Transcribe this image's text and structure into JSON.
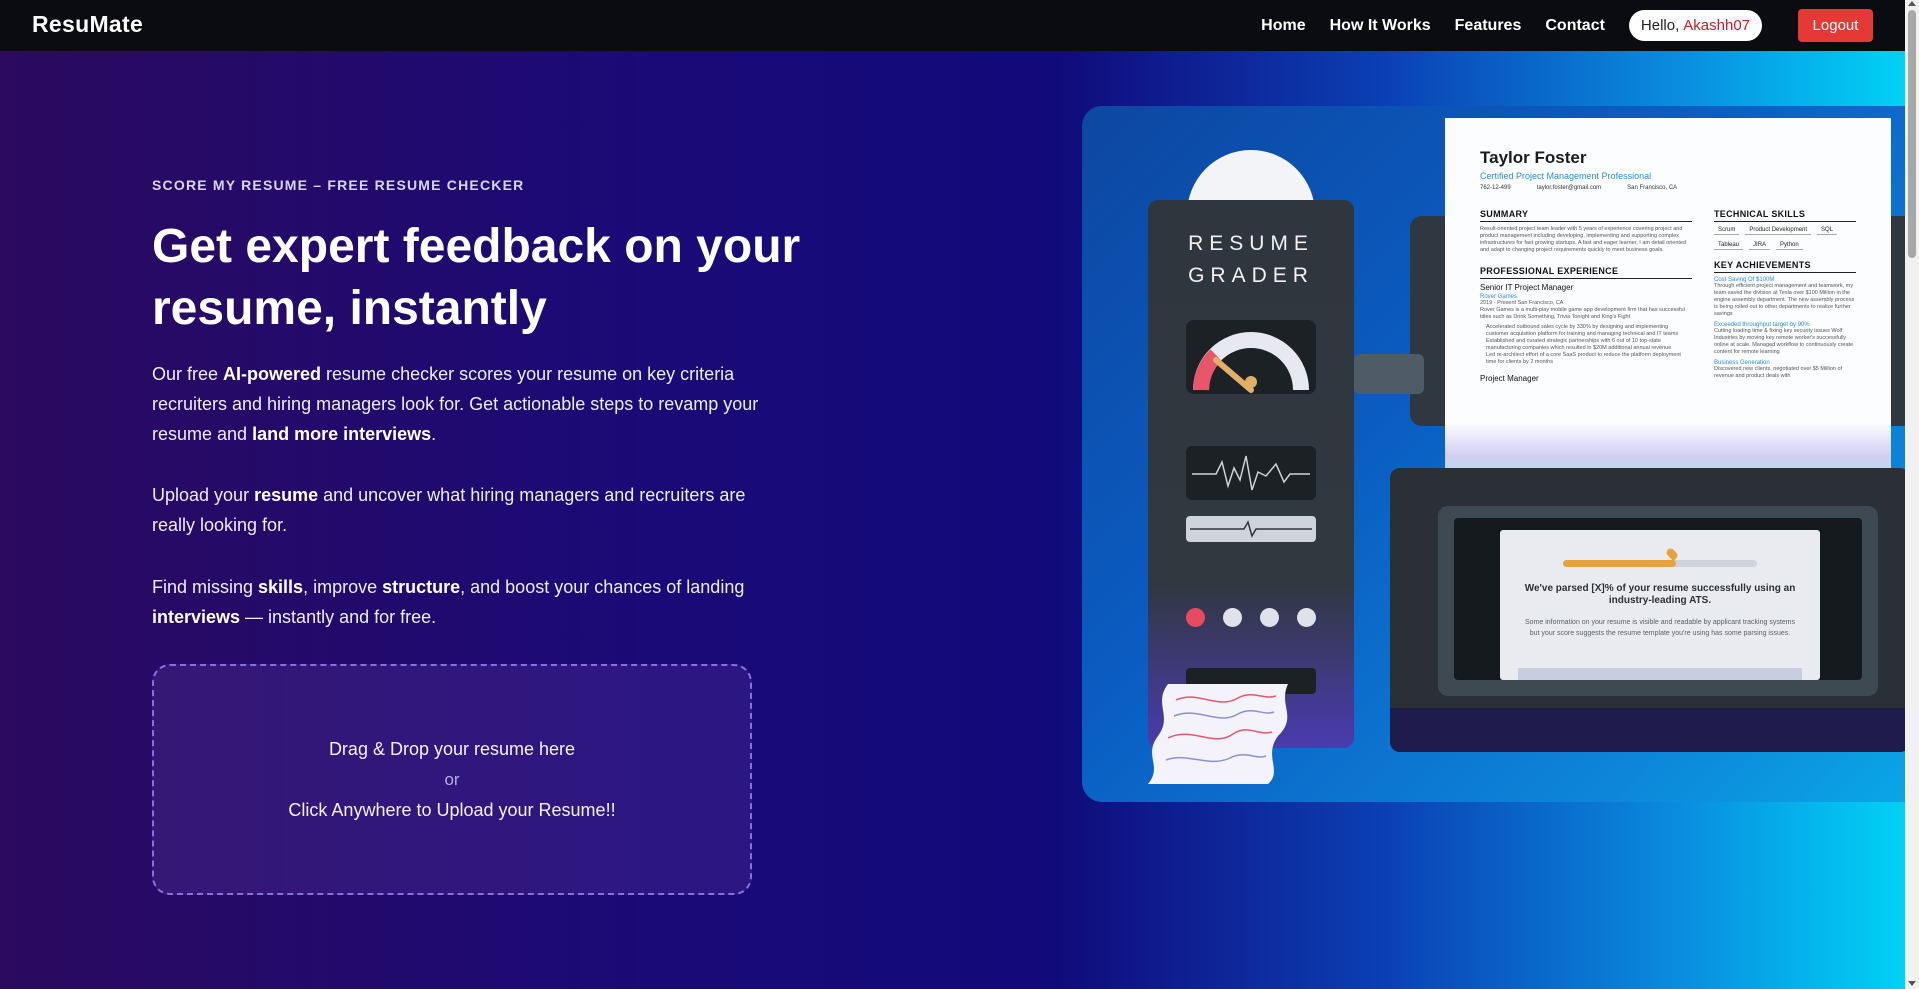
{
  "nav": {
    "logo": "ResuMate",
    "links": [
      "Home",
      "How It Works",
      "Features",
      "Contact"
    ],
    "greeting": "Hello,",
    "username": "Akashh07",
    "logout_label": "Logout"
  },
  "hero": {
    "eyebrow": "SCORE MY RESUME – FREE RESUME CHECKER",
    "headline": "Get expert feedback on your resume, instantly",
    "p1": {
      "a": "Our free ",
      "b": "AI-powered",
      "c": " resume checker scores your resume on key criteria recruiters and hiring managers look for. Get actionable steps to revamp your resume and ",
      "d": "land more interviews",
      "e": "."
    },
    "p2": {
      "a": "Upload your ",
      "b": "resume",
      "c": " and uncover what hiring managers and recruiters are really looking for."
    },
    "p3": {
      "a": "Find missing ",
      "b": "skills",
      "c": ", improve ",
      "d": "structure",
      "e": ", and boost your chances of landing ",
      "f": "interviews",
      "g": " — instantly and for free."
    }
  },
  "dropzone": {
    "line1": "Drag & Drop your resume here",
    "or": "or",
    "line2": "Click Anywhere to Upload your Resume!!"
  },
  "illustration": {
    "machine_title_1": "RESUME",
    "machine_title_2": "GRADER",
    "resume": {
      "name": "Taylor Foster",
      "title": "Certified Project Management Professional",
      "phone": "762-12-499",
      "email": "taylor.foster@gmail.com",
      "location": "San Francisco, CA",
      "summary_h": "SUMMARY",
      "summary": "Result-oriented project team leader with 5 years of experience covering project and product management including developing, implementing and supporting complex infrastructures for fast growing startups. A fast and eager learner, I am detail oriented and adapt to changing project requirements quickly to meet business goals.",
      "exp_h": "PROFESSIONAL EXPERIENCE",
      "job1": "Senior IT Project Manager",
      "company1": "Rover Games",
      "job1_meta": "2019 - Present   San Francisco, CA",
      "job1_desc": "Rover Games is a multi-play mobile game app development firm that has successful titles such as Drink Something, Trivia Tonight and King's Fight",
      "bullets": [
        "Accelerated outbound sales cycle by 330% by designing and implementing customer acquisition platform for training and managing technical and IT teams",
        "Established and curated strategic partnerships with 6 out of 10 top-state manufacturing companies which resulted in $20M additional annual revenue",
        "Led re-architect effort of a core SaaS product to reduce the platform deployment time for clients by 2 months"
      ],
      "job2": "Project Manager",
      "skills_h": "TECHNICAL SKILLS",
      "skills": [
        "Scrum",
        "Product Development",
        "SQL",
        "Tableau",
        "JIRA",
        "Python"
      ],
      "ach_h": "KEY ACHIEVEMENTS",
      "ach1": "Cost Saving Of $100M",
      "ach1_t": "Through efficient project management and teamwork, my team saved the division at Tesla over $100 Million in the engine assembly department. The new assembly process is being rolled out to other departments to realize further savings",
      "ach2": "Exceeded throughput target by 90%",
      "ach2_t": "Cutting loading time & fixing key security issues Wolf Industries by moving key remote worker's successfully online at scale. Managed workflow to continuously create content for remote learning",
      "ach3": "Business Generation",
      "ach3_t": "Discovered new clients, negotiated over $5 Million of revenue and product deals with"
    },
    "ats": {
      "headline": "We've parsed [X]% of your resume successfully using an industry-leading ATS.",
      "text": "Some information on your resume is visible and readable by applicant tracking systems but your score suggests the resume template you're using has some parsing issues."
    }
  },
  "colors": {
    "nav_bg": "#0b0c12",
    "logout_bg": "#e53935",
    "username": "#c0202b",
    "gradient_left": "#2b0a5f",
    "gradient_right": "#00d6f7"
  }
}
